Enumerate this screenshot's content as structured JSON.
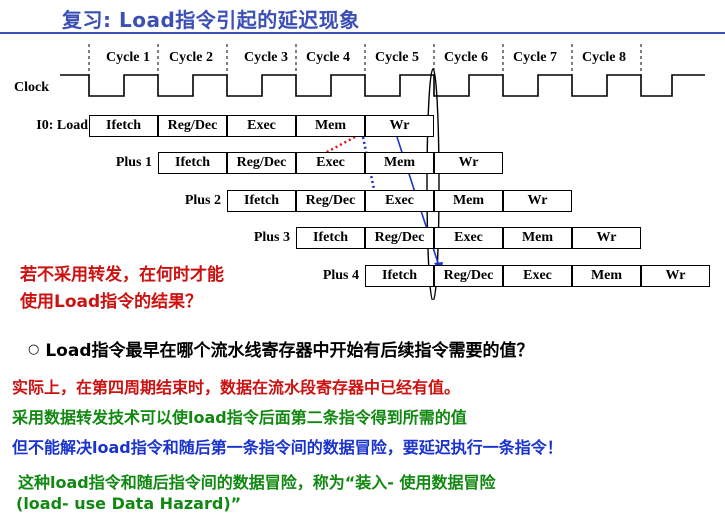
{
  "title": "复习: Load指令引起的延迟现象",
  "clock_label": "Clock",
  "cycles": [
    "Cycle 1",
    "Cycle 2",
    "Cycle 3",
    "Cycle 4",
    "Cycle 5",
    "Cycle 6",
    "Cycle 7",
    "Cycle 8"
  ],
  "rows": [
    {
      "label": "I0: Load",
      "stages": [
        "Ifetch",
        "Reg/Dec",
        "Exec",
        "Mem",
        "Wr"
      ]
    },
    {
      "label": "Plus 1",
      "stages": [
        "Ifetch",
        "Reg/Dec",
        "Exec",
        "Mem",
        "Wr"
      ]
    },
    {
      "label": "Plus 2",
      "stages": [
        "Ifetch",
        "Reg/Dec",
        "Exec",
        "Mem",
        "Wr"
      ]
    },
    {
      "label": "Plus 3",
      "stages": [
        "Ifetch",
        "Reg/Dec",
        "Exec",
        "Mem",
        "Wr"
      ]
    },
    {
      "label": "Plus 4",
      "stages": [
        "Ifetch",
        "Reg/Dec",
        "Exec",
        "Mem",
        "Wr"
      ]
    }
  ],
  "question": {
    "line1": "若不采用转发，在何时才能",
    "line2": "使用Load指令的结果？"
  },
  "bullet": "Load指令最早在哪个流水线寄存器中开始有后续指令需要的值？",
  "notes": {
    "n1": "实际上，在第四周期结束时，数据在流水段寄存器中已经有值。",
    "n2": "采用数据转发技术可以使load指令后面第二条指令得到所需的值",
    "n3": "但不能解决load指令和随后第一条指令间的数据冒险，要延迟执行一条指令！",
    "n4": "这种load指令和随后指令间的数据冒险，称为“装入- 使用数据冒险",
    "n5": "(load- use Data Hazard)”"
  },
  "colors": {
    "title": "#3b4fb5",
    "red": "#cc1111",
    "green": "#118811",
    "blue": "#1a33cc",
    "arrow_red": "#dd1111",
    "arrow_blue": "#1a33cc"
  }
}
